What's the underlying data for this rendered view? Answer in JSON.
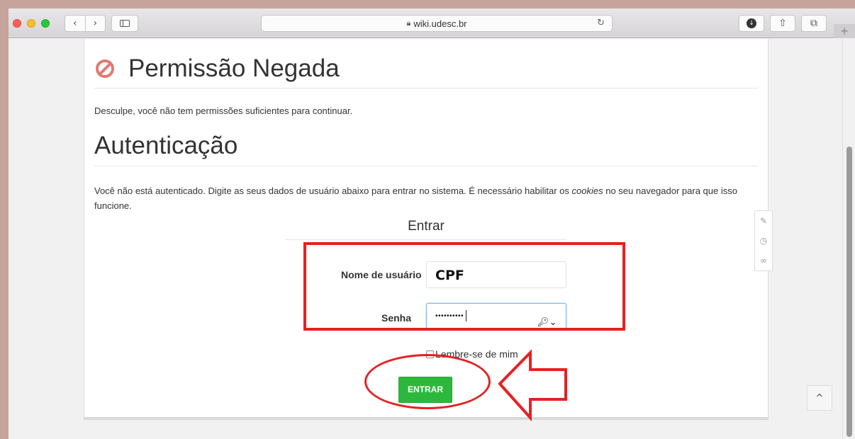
{
  "browser": {
    "url": "wiki.udesc.br",
    "back_glyph": "‹",
    "forward_glyph": "›",
    "reload_glyph": "↻",
    "download_glyph": "↓",
    "share_glyph": "⇧",
    "tabs_glyph": "⧉",
    "new_tab_glyph": "+"
  },
  "page": {
    "heading_denied": "Permissão Negada",
    "denied_message": "Desculpe, você não tem permissões suficientes para continuar.",
    "heading_auth": "Autenticação",
    "auth_message_part1": "Você não está autenticado. Digite as seus dados de usuário abaixo para entrar no sistema. É necessário habilitar os ",
    "auth_message_cookies": "cookies",
    "auth_message_part2": " no seu navegador para que isso funcione."
  },
  "login_form": {
    "legend": "Entrar",
    "username_label": "Nome de usuário",
    "username_value": "CPF",
    "password_label": "Senha",
    "password_value": "••••••••••",
    "key_glyph": "🔑︎⌄",
    "remember_label": "Lembre-se de mim",
    "submit_label": "ENTRAR"
  },
  "side_tools": {
    "edit_glyph": "✎",
    "history_glyph": "◷",
    "links_glyph": "∞"
  },
  "back_to_top_glyph": "^",
  "colors": {
    "annotation": "#e52121",
    "submit": "#2db83d",
    "deny_icon": "#e07a73"
  }
}
